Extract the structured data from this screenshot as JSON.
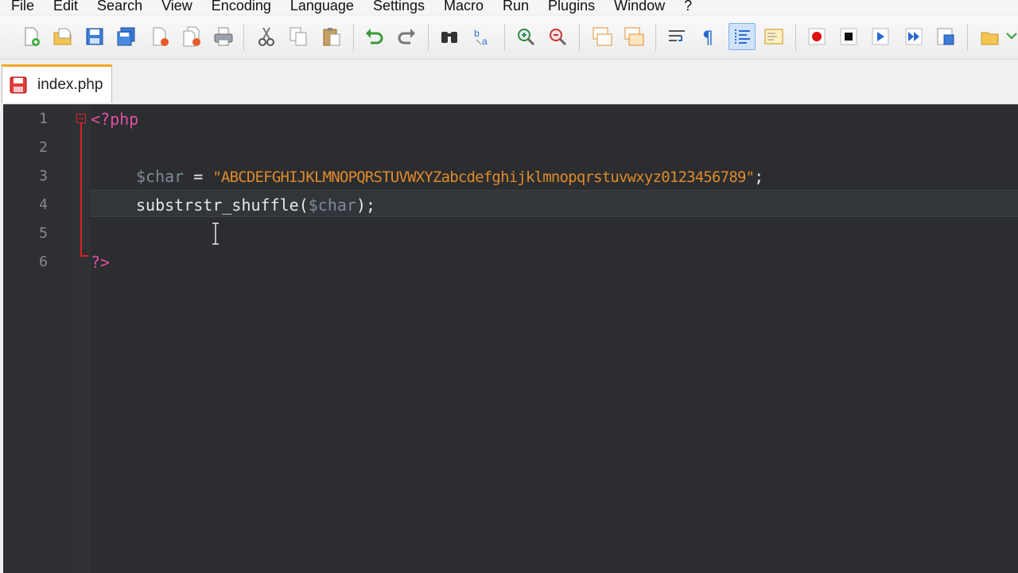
{
  "menu": [
    "File",
    "Edit",
    "Search",
    "View",
    "Encoding",
    "Language",
    "Settings",
    "Macro",
    "Run",
    "Plugins",
    "Window",
    "?"
  ],
  "toolbar": {
    "icons": [
      "new-file-icon",
      "open-file-icon",
      "save-icon",
      "save-all-icon",
      "close-icon",
      "close-all-icon",
      "print-icon",
      "cut-icon",
      "copy-icon",
      "paste-icon",
      "undo-icon",
      "redo-icon",
      "find-icon",
      "replace-icon",
      "zoom-in-icon",
      "zoom-out-icon",
      "sync-vertical-icon",
      "sync-horizontal-icon",
      "word-wrap-icon",
      "show-all-chars-icon",
      "indent-guide-icon",
      "doc-map-icon",
      "record-macro-icon",
      "stop-macro-icon",
      "play-macro-icon",
      "run-macro-multiple-icon",
      "save-macro-icon",
      "open-folder-icon",
      "more-icon"
    ]
  },
  "tab": {
    "label": "index.php",
    "icon": "file-modified-icon"
  },
  "editor": {
    "line_numbers": [
      "1",
      "2",
      "3",
      "4",
      "5",
      "6"
    ],
    "lines": {
      "l1_tag": "<?php",
      "l3_var": "$char",
      "l3_eq": " = ",
      "l3_str": "\"ABCDEFGHIJKLMNOPQRSTUVWXYZabcdefghijklmnopqrstuvwxyz0123456789\"",
      "l3_end": ";",
      "l4_func": "substrstr_shuffle(",
      "l4_var": "$char",
      "l4_end": ");",
      "l6_tag": "?>"
    }
  },
  "colors": {
    "accent": "#f5a623",
    "tag": "#e14fa2",
    "string": "#e08a2a",
    "variable": "#7e8b96",
    "editor_bg": "#2b2d30"
  }
}
